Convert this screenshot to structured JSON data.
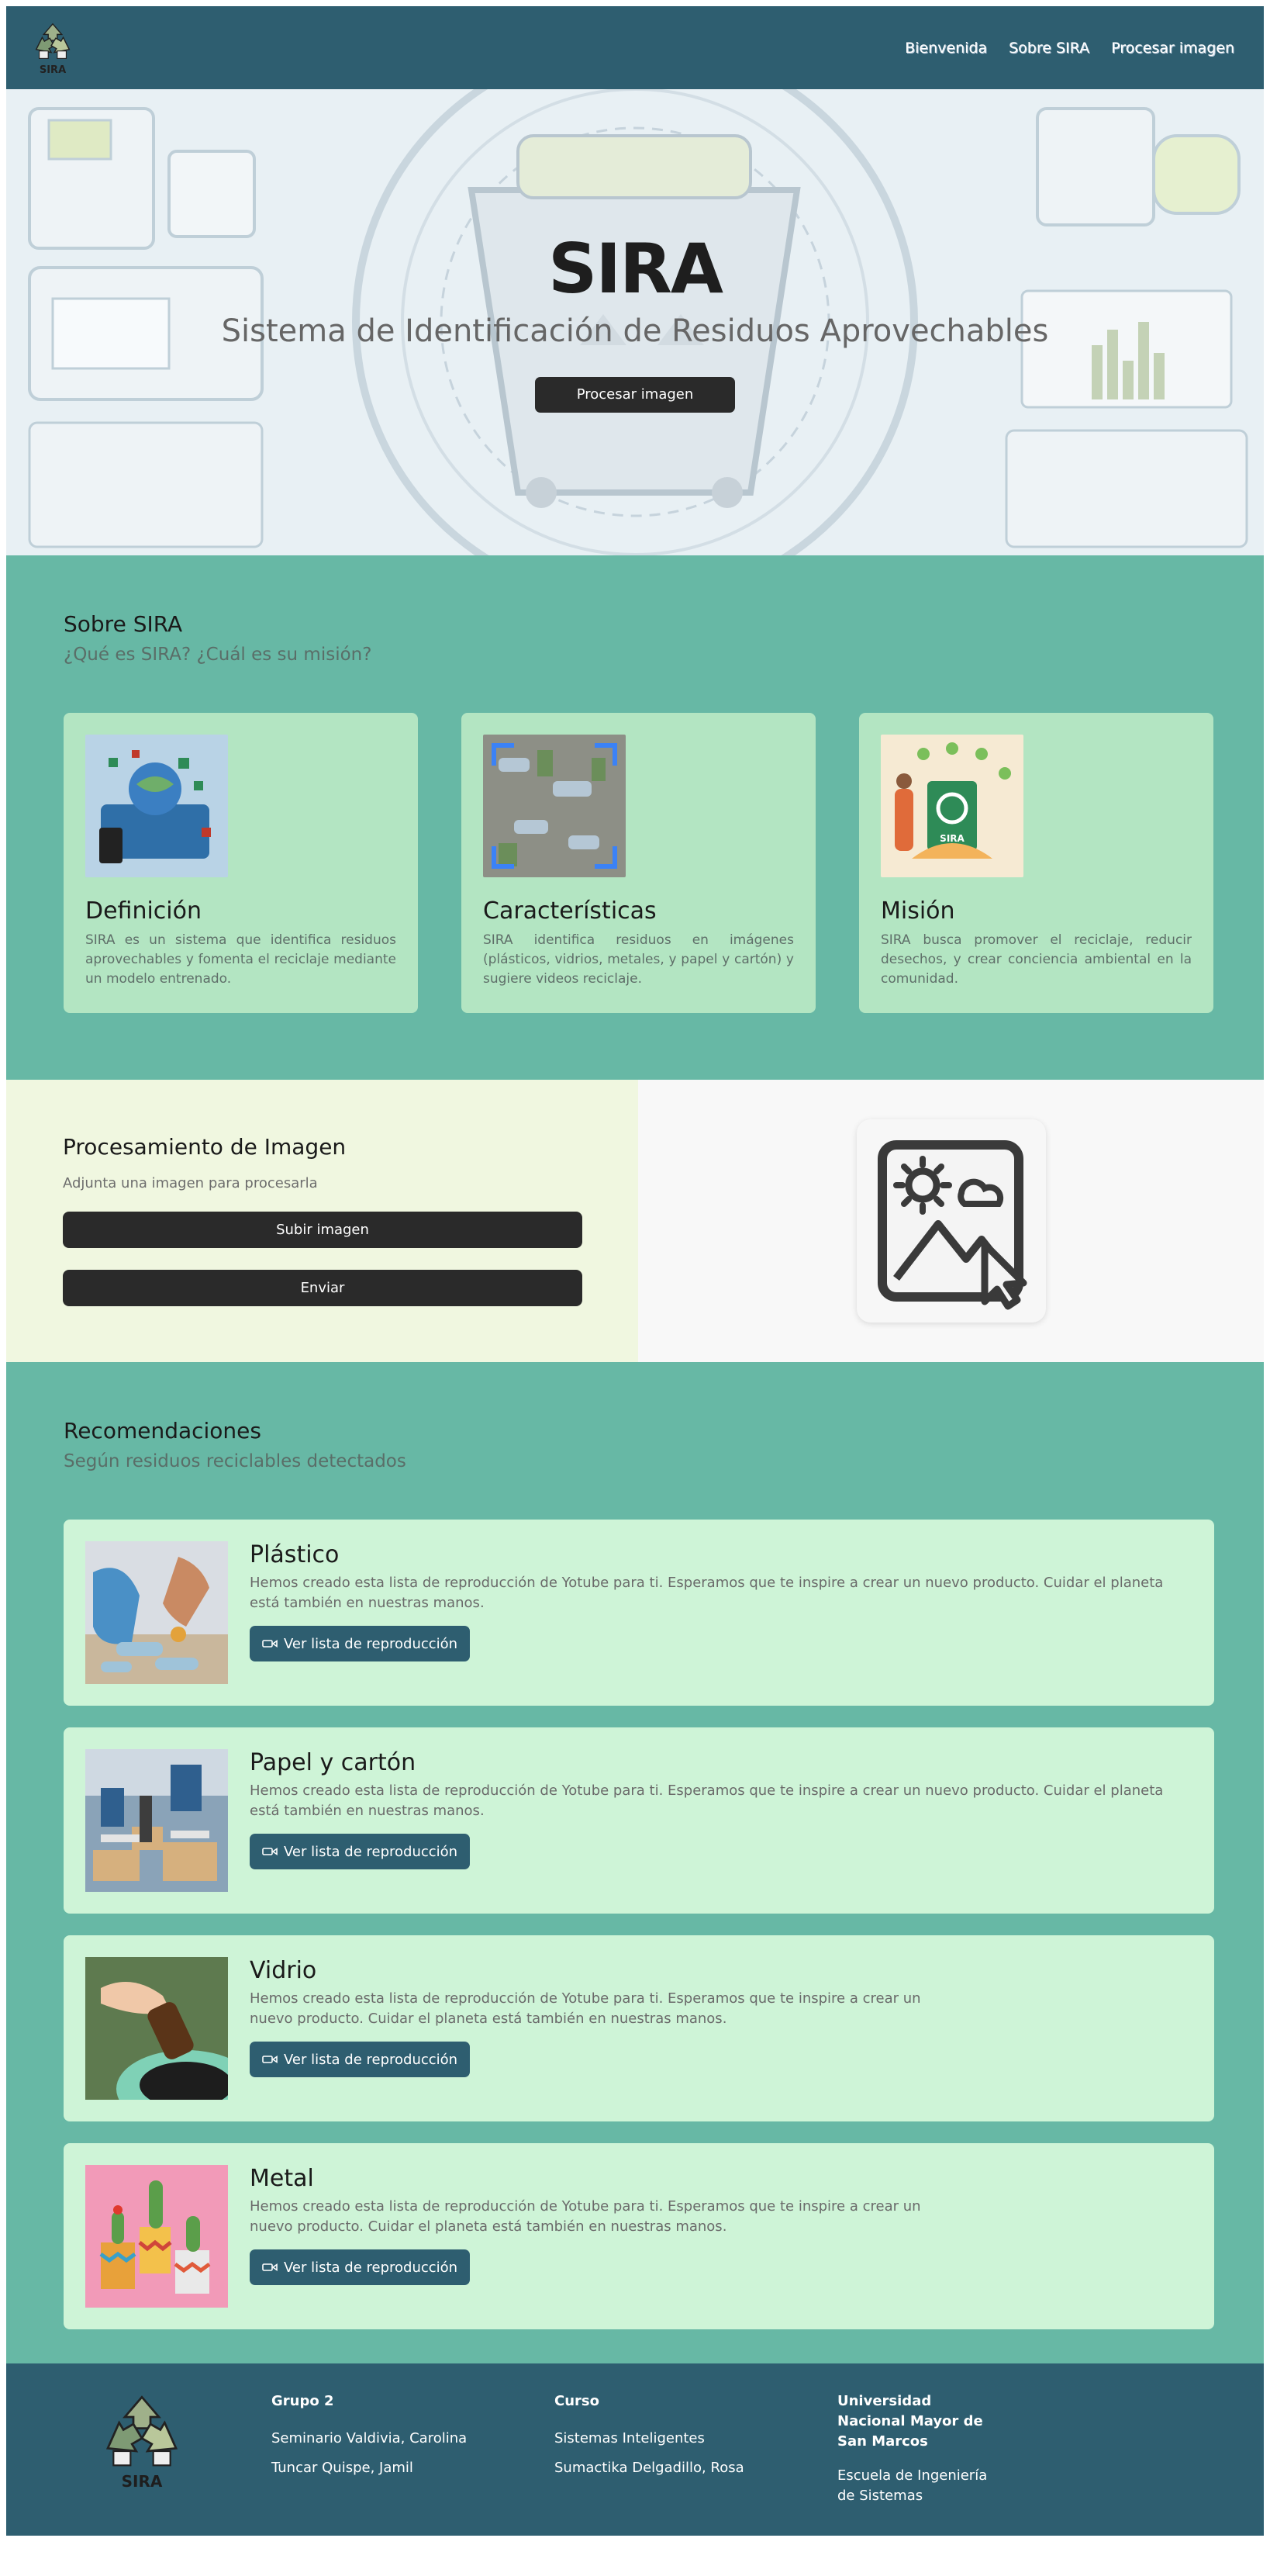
{
  "nav": {
    "logo_text": "SIRA",
    "links": [
      "Bienvenida",
      "Sobre SIRA",
      "Procesar imagen"
    ]
  },
  "hero": {
    "title": "SIRA",
    "subtitle": "Sistema de Identificación de Residuos Aprovechables",
    "button": "Procesar imagen"
  },
  "about": {
    "title": "Sobre SIRA",
    "subtitle": "¿Qué es SIRA? ¿Cuál es su misión?",
    "cards": [
      {
        "title": "Definición",
        "text": "SIRA es un sistema que identifica residuos aprovechables y fomenta el reciclaje mediante un modelo entrenado."
      },
      {
        "title": "Características",
        "text": "SIRA identifica residuos en imágenes (plásticos, vidrios, metales, y papel y cartón) y sugiere videos reciclaje."
      },
      {
        "title": "Misión",
        "text": "SIRA busca promover el reciclaje, reducir desechos, y crear conciencia ambiental en la comunidad.",
        "img_label": "SIRA"
      }
    ]
  },
  "process": {
    "title": "Procesamiento de Imagen",
    "subtitle": "Adjunta una imagen para procesarla",
    "upload_button": "Subir imagen",
    "send_button": "Enviar"
  },
  "recs": {
    "title": "Recomendaciones",
    "subtitle": "Según residuos reciclables detectados",
    "items": [
      {
        "title": "Plástico",
        "text": "Hemos creado esta lista de reproducción de Yotube para ti. Esperamos que te inspire a crear un nuevo producto. Cuidar el planeta está también en nuestras manos.",
        "button": "Ver lista de reproducción"
      },
      {
        "title": "Papel y cartón",
        "text": "Hemos creado esta lista de reproducción de Yotube para ti. Esperamos que te inspire a crear un nuevo producto. Cuidar el planeta está también en nuestras manos.",
        "button": "Ver lista de reproducción"
      },
      {
        "title": "Vidrio",
        "text": "Hemos creado esta lista de reproducción de Yotube para ti. Esperamos que te inspire a crear un nuevo producto. Cuidar el planeta está también en nuestras manos.",
        "button": "Ver lista de reproducción"
      },
      {
        "title": "Metal",
        "text": "Hemos creado esta lista de reproducción de Yotube para ti. Esperamos que te inspire a crear un nuevo producto. Cuidar el planeta está también en nuestras manos.",
        "button": "Ver lista de reproducción"
      }
    ]
  },
  "footer": {
    "logo_text": "SIRA",
    "group": {
      "heading": "Grupo 2",
      "members": [
        "Seminario Valdivia, Carolina",
        "Tuncar Quispe, Jamil"
      ]
    },
    "course": {
      "heading": "Curso",
      "lines": [
        "Sistemas Inteligentes",
        "Sumactika Delgadillo, Rosa"
      ]
    },
    "university": {
      "heading": "Universidad Nacional Mayor de San Marcos",
      "lines": [
        "Escuela de Ingeniería de Sistemas"
      ]
    }
  },
  "colors": {
    "nav_bg": "#2e5e70",
    "teal_section": "#67b8a5",
    "card_bg": "#b3e5c2",
    "rec_card_bg": "#cef4d7",
    "process_left_bg": "#f0f7e0",
    "dark_button": "#2a2a2a"
  }
}
